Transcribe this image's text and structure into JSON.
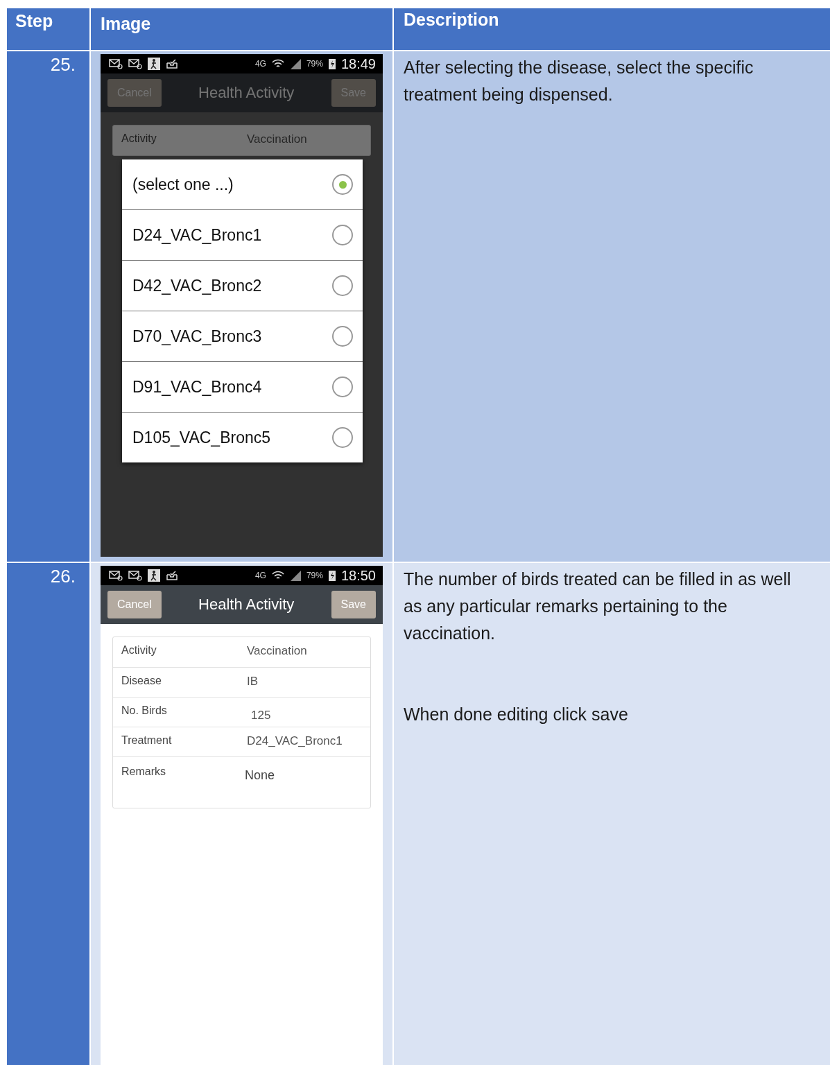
{
  "table": {
    "columns": [
      "Step",
      "Image",
      "Description"
    ],
    "rows": [
      {
        "step": "25.",
        "phone": {
          "dimmed": true,
          "network": "4G",
          "battery": "79%",
          "time": "18:49",
          "cancel": "Cancel",
          "title": "Health Activity",
          "save": "Save",
          "fields": [
            {
              "label": "Activity",
              "value": "Vaccination",
              "kind": "text"
            }
          ],
          "dialog": {
            "options": [
              {
                "label": "(select one ...)",
                "selected": true
              },
              {
                "label": "D24_VAC_Bronc1",
                "selected": false
              },
              {
                "label": "D42_VAC_Bronc2",
                "selected": false
              },
              {
                "label": "D70_VAC_Bronc3",
                "selected": false
              },
              {
                "label": "D91_VAC_Bronc4",
                "selected": false
              },
              {
                "label": "D105_VAC_Bronc5",
                "selected": false
              }
            ]
          }
        },
        "description": [
          "After selecting the disease, select the specific treatment being dispensed."
        ]
      },
      {
        "step": "26.",
        "phone": {
          "dimmed": false,
          "network": "4G",
          "battery": "79%",
          "time": "18:50",
          "cancel": "Cancel",
          "title": "Health Activity",
          "save": "Save",
          "fields": [
            {
              "label": "Activity",
              "value": "Vaccination",
              "kind": "text"
            },
            {
              "label": "Disease",
              "value": "IB",
              "kind": "text"
            },
            {
              "label": "No. Birds",
              "value": "125",
              "kind": "input"
            },
            {
              "label": "Treatment",
              "value": "D24_VAC_Bronc1",
              "kind": "text"
            },
            {
              "label": "Remarks",
              "value": "None",
              "kind": "textarea"
            }
          ]
        },
        "description": [
          "The number of birds treated can be filled in as well as any particular remarks pertaining to the vaccination.",
          "When done editing click save"
        ]
      }
    ]
  }
}
